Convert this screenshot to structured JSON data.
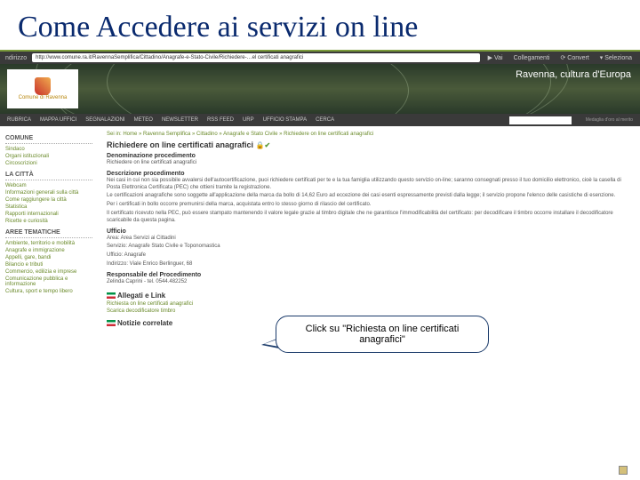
{
  "slide": {
    "title": "Come Accedere ai servizi on line"
  },
  "browser": {
    "address_label": "ndirizzo",
    "url": "http://www.comune.ra.it/RavennaSemplifica/Cittadino/Anagrafe-e-Stato-Civile/Richiedere-…el certificati anagrafici",
    "go": "Vai",
    "links": "Collegamenti",
    "convert": "Convert",
    "select": "Seleziona"
  },
  "banner": {
    "org": "Comune di Ravenna",
    "tag": "Ravenna, cultura d'Europa"
  },
  "tabs": {
    "items": [
      "RUBRICA",
      "MAPPA UFFICI",
      "SEGNALAZIONI",
      "METEO",
      "NEWSLETTER",
      "RSS FEED",
      "URP",
      "UFFICIO STAMPA"
    ],
    "search_label": "CERCA",
    "right": "Medaglia d'oro al merito"
  },
  "sidebar": {
    "g1": {
      "h": "COMUNE",
      "items": [
        "Sindaco",
        "Organi istituzionali",
        "Circoscrizioni"
      ]
    },
    "g2": {
      "h": "LA CITTÀ",
      "items": [
        "Webcam",
        "Informazioni generali sulla città",
        "Come raggiungere la città",
        "Statistica",
        "Rapporti internazionali",
        "Ricette e curiosità"
      ]
    },
    "g3": {
      "h": "AREE TEMATICHE",
      "items": [
        "Ambiente, territorio e mobilità",
        "Anagrafe e immigrazione",
        "Appelli, gare, bandi",
        "Bilancio e tributi",
        "Commercio, edilizia e imprese",
        "Comunicazione pubblica e informazione",
        "Cultura, sport e tempo libero"
      ]
    }
  },
  "main": {
    "breadcrumb": "Sei in: Home » Ravenna Semplifica » Cittadino » Anagrafe e Stato Civile » Richiedere on line certificati anagrafici",
    "page_title": "Richiedere on line certificati anagrafici",
    "s1_h": "Denominazione procedimento",
    "s1_t": "Richiedere on line certificati anagrafici",
    "s2_h": "Descrizione procedimento",
    "s2_t1": "Nei casi in cui non sia possibile avvalersi dell'autocertificazione, puoi richiedere certificati per te e la tua famiglia utilizzando questo servizio on-line; saranno consegnati presso il tuo domicilio elettronico, cioè la casella di Posta Elettronica Certificata (PEC) che ottieni tramite la registrazione.",
    "s2_t2": "Le certificazioni anagrafiche sono soggette all'applicazione della marca da bollo di 14,62 Euro ad eccezione dei casi esenti espressamente previsti dalla legge; il servizio propone l'elenco delle casistiche di esenzione.",
    "s2_t3": "Per i certificati in bollo occorre premunirsi della marca, acquistata entro lo stesso giorno di rilascio del certificato.",
    "s2_t4": "Il certificato ricevuto nella PEC, può essere stampato mantenendo il valore legale grazie al timbro digitale che ne garantisce l'immodificabilità del certificato: per decodificare il timbro occorre installare il decodificatore scaricabile da questa pagina.",
    "uff_h": "Ufficio",
    "uff_area": "Area: Area Servizi ai Cittadini",
    "uff_serv": "Servizio: Anagrafe Stato Civile e Toponomastica",
    "uff_uff": "Ufficio: Anagrafe",
    "uff_ind": "Indirizzo: Viale Enrico Berlinguer, 68",
    "resp_h": "Responsabile del Procedimento",
    "resp_t": "Zelinda Caprini - tel. 0544.482252",
    "att_h": "Allegati e Link",
    "att_l1": "Richiesta on line certificati anagrafici",
    "att_l2": "Scarica decodificatore timbro",
    "not_h": "Notizie correlate"
  },
  "callout": {
    "text": "Click su \"Richiesta on line certificati anagrafici\""
  }
}
